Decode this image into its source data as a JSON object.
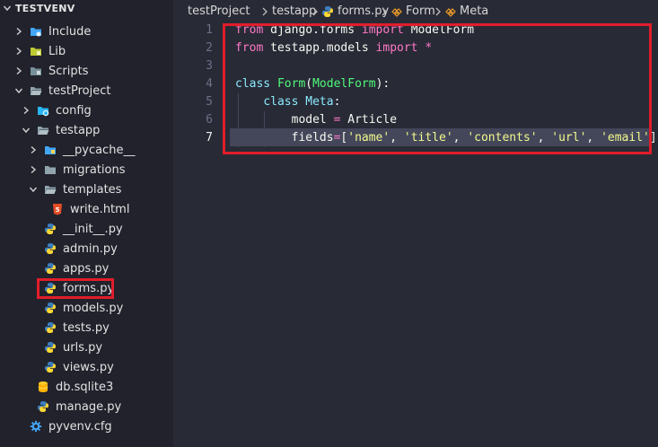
{
  "explorer": {
    "root_label": "TESTVENV",
    "items": [
      {
        "label": "Include",
        "icon": "folder-include-icon"
      },
      {
        "label": "Lib",
        "icon": "folder-lib-icon"
      },
      {
        "label": "Scripts",
        "icon": "folder-scripts-icon"
      },
      {
        "label": "testProject",
        "icon": "folder-open-icon"
      },
      {
        "label": "config",
        "icon": "folder-config-icon"
      },
      {
        "label": "testapp",
        "icon": "folder-open-icon"
      },
      {
        "label": "__pycache__",
        "icon": "folder-python-icon"
      },
      {
        "label": "migrations",
        "icon": "folder-icon"
      },
      {
        "label": "templates",
        "icon": "folder-open-icon"
      },
      {
        "label": "write.html",
        "icon": "html-file-icon"
      },
      {
        "label": "__init__.py",
        "icon": "python-file-icon"
      },
      {
        "label": "admin.py",
        "icon": "python-file-icon"
      },
      {
        "label": "apps.py",
        "icon": "python-file-icon"
      },
      {
        "label": "forms.py",
        "icon": "python-file-icon"
      },
      {
        "label": "models.py",
        "icon": "python-file-icon"
      },
      {
        "label": "tests.py",
        "icon": "python-file-icon"
      },
      {
        "label": "urls.py",
        "icon": "python-file-icon"
      },
      {
        "label": "views.py",
        "icon": "python-file-icon"
      },
      {
        "label": "db.sqlite3",
        "icon": "database-icon"
      },
      {
        "label": "manage.py",
        "icon": "python-file-icon"
      },
      {
        "label": "pyvenv.cfg",
        "icon": "gear-file-icon"
      }
    ]
  },
  "breadcrumb": {
    "project": "testProject",
    "app": "testapp",
    "file": "forms.py",
    "class": "Form",
    "inner": "Meta"
  },
  "editor": {
    "line_numbers": [
      "1",
      "2",
      "3",
      "4",
      "5",
      "6",
      "7"
    ],
    "active_line": "7",
    "lines": {
      "l1": {
        "kw1": "from",
        "mod": "django.forms",
        "kw2": "import",
        "name": "ModelForm"
      },
      "l2": {
        "kw1": "from",
        "mod": "testapp.models",
        "kw2": "import",
        "star": "*"
      },
      "l4": {
        "kw": "class",
        "name": "Form",
        "open": "(",
        "base": "ModelForm",
        "close": "):"
      },
      "l5": {
        "kw": "class",
        "name": "Meta",
        "colon": ":"
      },
      "l6": {
        "attr": "model",
        "eq": "=",
        "value": "Article"
      },
      "l7": {
        "attr": "fields",
        "eq": "=",
        "open": "[",
        "v1": "'name'",
        "v2": "'title'",
        "v3": "'contents'",
        "v4": "'url'",
        "v5": "'email'",
        "sep": ", ",
        "close": "]"
      }
    }
  },
  "colors": {
    "highlight_box": "#e11d2a",
    "keyword": "#ff79c6",
    "class_name": "#8be9fd",
    "base_class": "#50fa7b",
    "string": "#f1fa8c"
  }
}
